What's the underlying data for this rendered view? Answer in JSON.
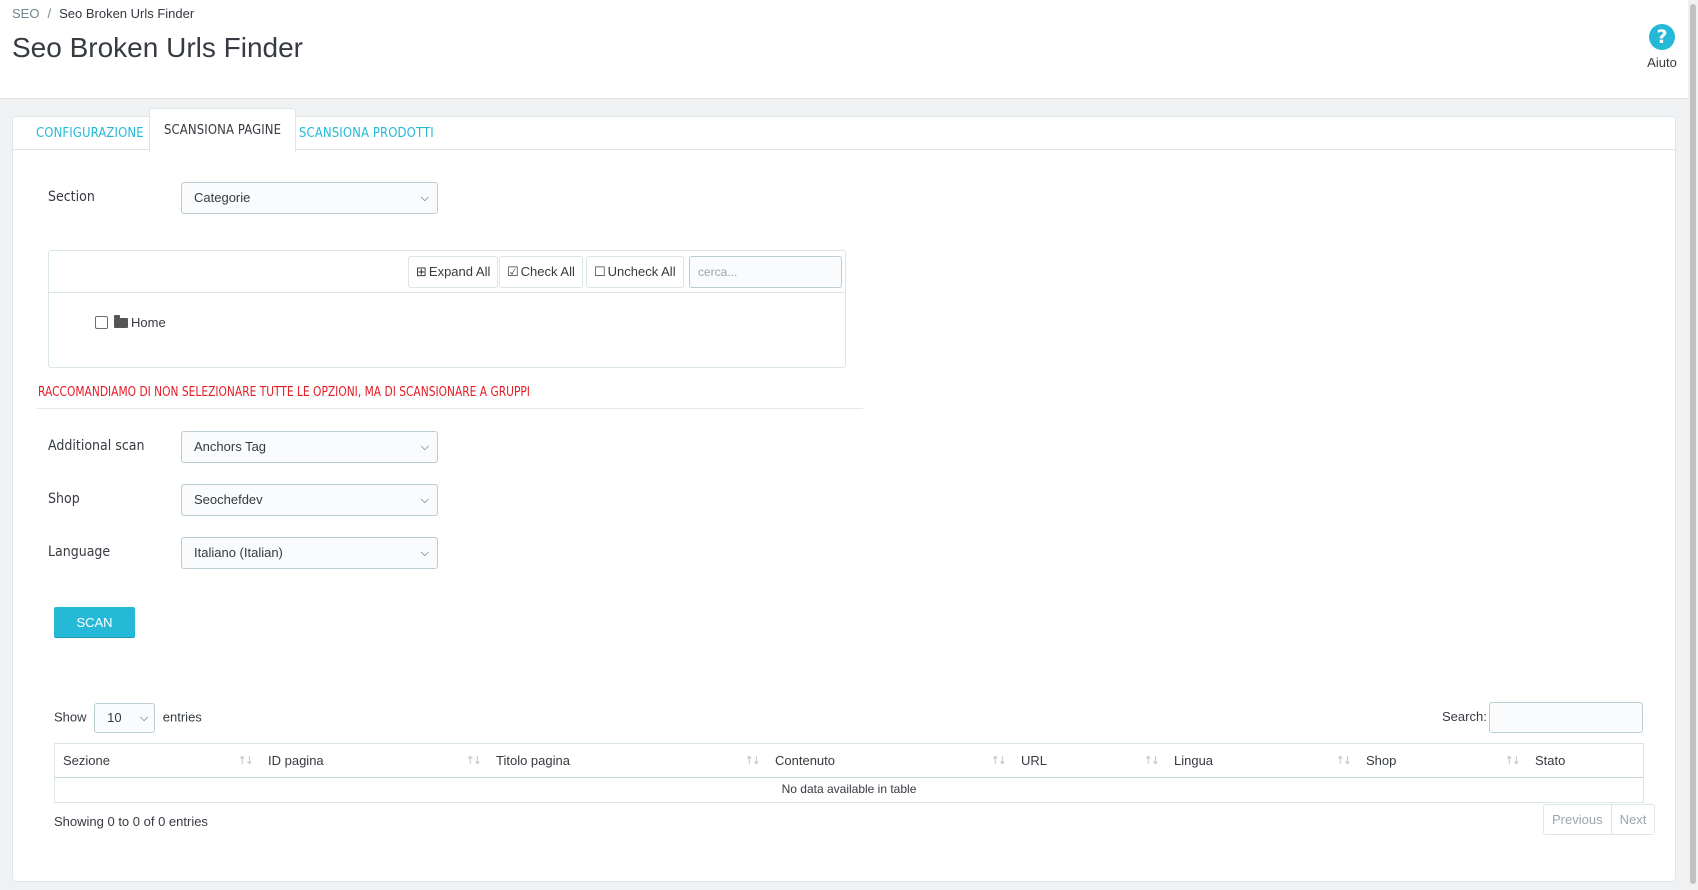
{
  "header": {
    "breadcrumb": {
      "parent": "SEO",
      "separator": "/",
      "current": "Seo Broken Urls Finder"
    },
    "title": "Seo Broken Urls Finder",
    "help": {
      "icon": "?",
      "label": "Aiuto"
    }
  },
  "tabs": [
    {
      "label": "CONFIGURAZIONE",
      "active": false
    },
    {
      "label": "SCANSIONA PAGINE",
      "active": true
    },
    {
      "label": "SCANSIONA PRODOTTI",
      "active": false
    }
  ],
  "form": {
    "section": {
      "label": "Section",
      "value": "Categorie"
    },
    "tree": {
      "expand_all": "Expand All",
      "check_all": "Check All",
      "uncheck_all": "Uncheck All",
      "search_placeholder": "cerca...",
      "items": [
        {
          "label": "Home",
          "checked": false
        }
      ]
    },
    "warning": "RACCOMANDIAMO DI NON SELEZIONARE TUTTE LE OPZIONI, MA DI SCANSIONARE A GRUPPI",
    "additional_scan": {
      "label": "Additional scan",
      "value": "Anchors Tag"
    },
    "shop": {
      "label": "Shop",
      "value": "Seochefdev"
    },
    "language": {
      "label": "Language",
      "value": "Italiano (Italian)"
    },
    "scan_button": "SCAN"
  },
  "datatable": {
    "show_label": "Show",
    "length_value": "10",
    "entries_label": "entries",
    "search_label": "Search:",
    "columns": [
      "Sezione",
      "ID pagina",
      "Titolo pagina",
      "Contenuto",
      "URL",
      "Lingua",
      "Shop",
      "Stato"
    ],
    "empty_message": "No data available in table",
    "info": "Showing 0 to 0 of 0 entries",
    "previous": "Previous",
    "next": "Next"
  },
  "colors": {
    "accent": "#25b9d7",
    "warning": "#e41c25",
    "text": "#363a41"
  }
}
